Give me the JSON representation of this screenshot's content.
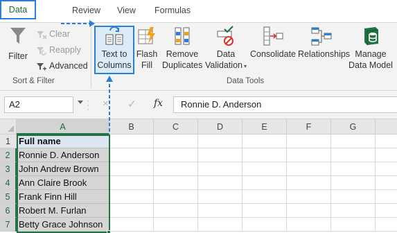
{
  "tabs": {
    "data": "Data",
    "review": "Review",
    "view": "View",
    "formulas": "Formulas"
  },
  "ribbon": {
    "sort_filter": {
      "filter": "Filter",
      "clear": "Clear",
      "reapply": "Reapply",
      "advanced": "Advanced",
      "group_label": "Sort & Filter"
    },
    "data_tools": {
      "text_to_columns_line1": "Text to",
      "text_to_columns_line2": "Columns",
      "flash_fill_line1": "Flash",
      "flash_fill_line2": "Fill",
      "remove_duplicates_line1": "Remove",
      "remove_duplicates_line2": "Duplicates",
      "data_validation_line1": "Data",
      "data_validation_line2": "Validation",
      "consolidate": "Consolidate",
      "relationships": "Relationships",
      "manage_data_model_line1": "Manage",
      "manage_data_model_line2": "Data Model",
      "group_label": "Data Tools"
    }
  },
  "formula_bar": {
    "name_box": "A2",
    "cancel_icon": "×",
    "enter_icon": "✓",
    "fx": "fx",
    "content": "Ronnie D. Anderson"
  },
  "grid": {
    "columns": [
      "A",
      "B",
      "C",
      "D",
      "E",
      "F",
      "G"
    ],
    "rows": [
      "1",
      "2",
      "3",
      "4",
      "5",
      "6",
      "7"
    ],
    "column_a": [
      "Full name",
      "Ronnie D. Anderson",
      "John Andrew Brown",
      "Ann Claire Brook",
      "Frank Finn Hill",
      "Robert M. Furlan",
      "Betty Grace Johnson"
    ]
  },
  "colors": {
    "accent_green": "#217346",
    "callout_blue": "#2b7fd4",
    "header_fill": "#dce6f2",
    "selection_fill": "#d6d6d6"
  },
  "icons": [
    "filter-icon",
    "clear-icon",
    "reapply-icon",
    "advanced-icon",
    "text-to-columns-icon",
    "flash-fill-icon",
    "remove-duplicates-icon",
    "data-validation-icon",
    "consolidate-icon",
    "relationships-icon",
    "manage-data-model-icon"
  ]
}
